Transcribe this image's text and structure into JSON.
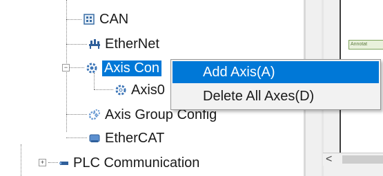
{
  "tree": {
    "items": [
      {
        "label": "CAN",
        "icon": "can-bus-icon"
      },
      {
        "label": "EtherNet",
        "icon": "ethernet-network-icon"
      },
      {
        "label": "Axis Con",
        "icon": "axis-config-gear-icon"
      },
      {
        "label": "Axis0",
        "icon": "axis-gear-icon"
      },
      {
        "label": "Axis Group Config",
        "icon": "axis-group-gear-icon"
      },
      {
        "label": "EtherCAT",
        "icon": "ethercat-icon"
      },
      {
        "label": "PLC Communication",
        "icon": "plc-communication-icon"
      }
    ]
  },
  "context_menu": {
    "items": [
      {
        "label": "Add Axis(A)"
      },
      {
        "label": "Delete All Axes(D)"
      }
    ]
  },
  "right_pane": {
    "block_label": "Annotat",
    "scroll_left_glyph": "<"
  },
  "colors": {
    "selection": "#0078d7",
    "menu_bg": "#f2f2f2"
  }
}
